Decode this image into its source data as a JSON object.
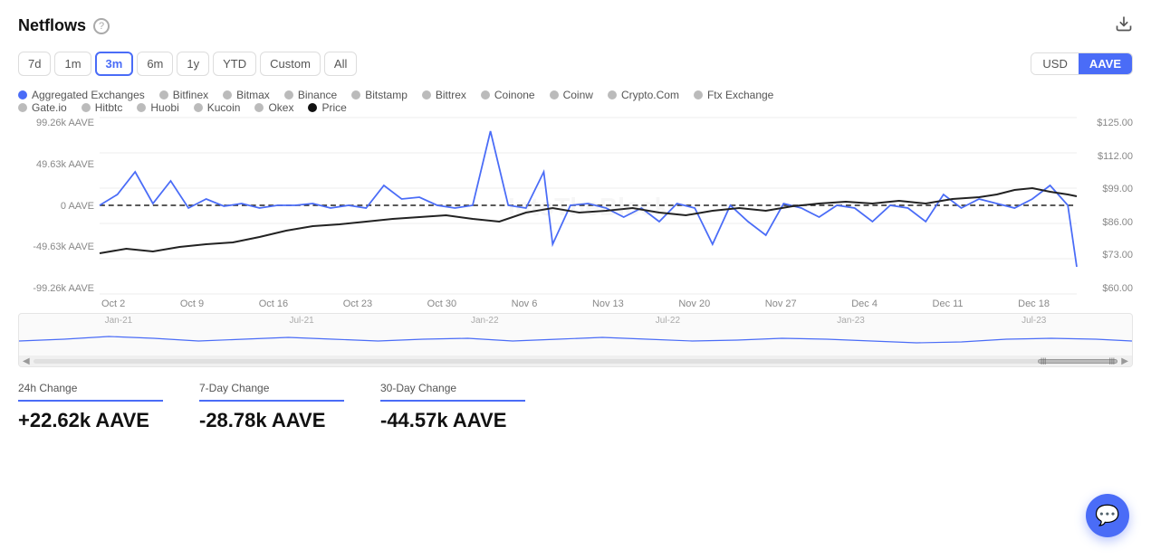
{
  "header": {
    "title": "Netflows",
    "download_label": "⬇",
    "help_label": "?"
  },
  "time_buttons": [
    {
      "label": "7d",
      "key": "7d",
      "active": false
    },
    {
      "label": "1m",
      "key": "1m",
      "active": false
    },
    {
      "label": "3m",
      "key": "3m",
      "active": true
    },
    {
      "label": "6m",
      "key": "6m",
      "active": false
    },
    {
      "label": "1y",
      "key": "1y",
      "active": false
    },
    {
      "label": "YTD",
      "key": "ytd",
      "active": false
    },
    {
      "label": "Custom",
      "key": "custom",
      "active": false
    },
    {
      "label": "All",
      "key": "all",
      "active": false
    }
  ],
  "currency_buttons": [
    {
      "label": "USD",
      "active": false
    },
    {
      "label": "AAVE",
      "active": true
    }
  ],
  "legend": [
    {
      "label": "Aggregated Exchanges",
      "color": "#4a6cf7",
      "filled": true
    },
    {
      "label": "Bitfinex",
      "color": "#bbb",
      "filled": false
    },
    {
      "label": "Bitmax",
      "color": "#bbb",
      "filled": false
    },
    {
      "label": "Binance",
      "color": "#bbb",
      "filled": false
    },
    {
      "label": "Bitstamp",
      "color": "#bbb",
      "filled": false
    },
    {
      "label": "Bittrex",
      "color": "#bbb",
      "filled": false
    },
    {
      "label": "Coinone",
      "color": "#bbb",
      "filled": false
    },
    {
      "label": "Coinw",
      "color": "#bbb",
      "filled": false
    },
    {
      "label": "Crypto.Com",
      "color": "#bbb",
      "filled": false
    },
    {
      "label": "Ftx Exchange",
      "color": "#bbb",
      "filled": false
    },
    {
      "label": "Gate.io",
      "color": "#bbb",
      "filled": false
    },
    {
      "label": "Hitbtc",
      "color": "#bbb",
      "filled": false
    },
    {
      "label": "Huobi",
      "color": "#bbb",
      "filled": false
    },
    {
      "label": "Kucoin",
      "color": "#bbb",
      "filled": false
    },
    {
      "label": "Okex",
      "color": "#bbb",
      "filled": false
    },
    {
      "label": "Price",
      "color": "#111",
      "filled": true
    }
  ],
  "y_axis_left": [
    "99.26k AAVE",
    "49.63k AAVE",
    "0 AAVE",
    "-49.63k AAVE",
    "-99.26k AAVE"
  ],
  "y_axis_right": [
    "$125.00",
    "$112.00",
    "$99.00",
    "$86.00",
    "$73.00",
    "$60.00"
  ],
  "x_axis": [
    "Oct 2",
    "Oct 9",
    "Oct 16",
    "Oct 23",
    "Oct 30",
    "Nov 6",
    "Nov 13",
    "Nov 20",
    "Nov 27",
    "Dec 4",
    "Dec 11",
    "Dec 18"
  ],
  "mini_labels": [
    "Jan-21",
    "Jul-21",
    "Jan-22",
    "Jul-22",
    "Jan-23",
    "Jul-23"
  ],
  "stats": [
    {
      "label": "24h Change",
      "value": "+22.62k AAVE",
      "type": "positive"
    },
    {
      "label": "7-Day Change",
      "value": "-28.78k AAVE",
      "type": "negative"
    },
    {
      "label": "30-Day Change",
      "value": "-44.57k AAVE",
      "type": "negative"
    }
  ],
  "watermark": "IntoTheBlock"
}
